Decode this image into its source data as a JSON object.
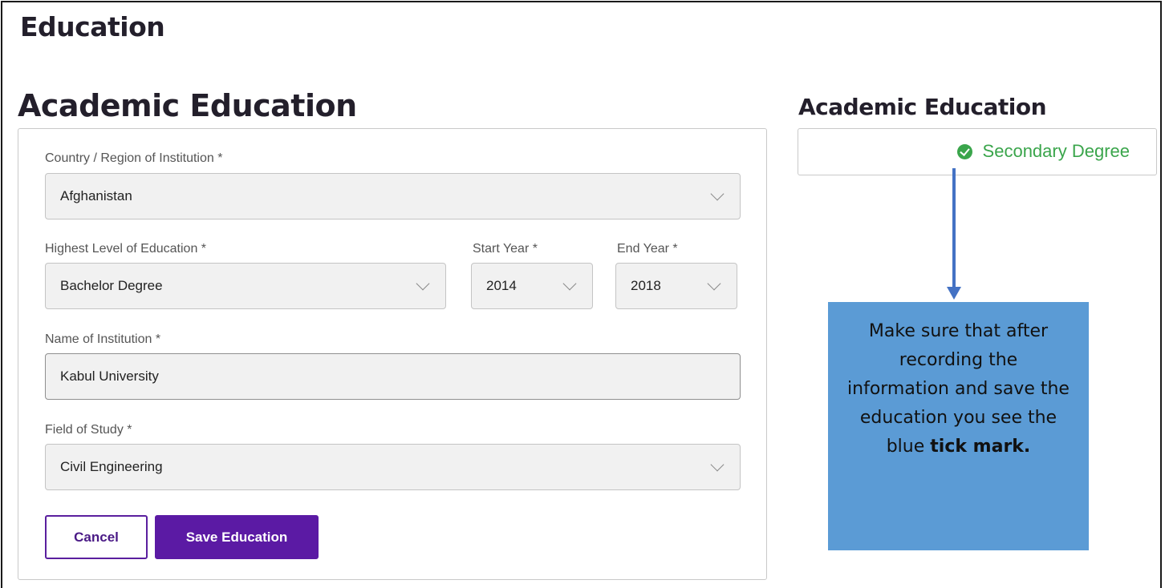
{
  "page": {
    "title": "Education",
    "section_title": "Academic Education"
  },
  "form": {
    "country": {
      "label": "Country / Region of Institution *",
      "value": "Afghanistan"
    },
    "level": {
      "label": "Highest Level of Education *",
      "value": "Bachelor Degree"
    },
    "start_year": {
      "label": "Start Year *",
      "value": "2014"
    },
    "end_year": {
      "label": "End Year *",
      "value": "2018"
    },
    "institution": {
      "label": "Name of Institution *",
      "value": "Kabul University"
    },
    "field_of_study": {
      "label": "Field of Study *",
      "value": "Civil Engineering"
    },
    "cancel_label": "Cancel",
    "save_label": "Save Education"
  },
  "summary": {
    "title": "Academic Education",
    "item_label": "Secondary Degree",
    "item_icon": "check-circle-icon",
    "item_color": "#3aa54b"
  },
  "callout": {
    "text_before": "Make sure that after recording the information and save the education you see the blue ",
    "text_bold": "tick mark.",
    "background": "#5b9bd5",
    "arrow_color": "#4472c4"
  },
  "colors": {
    "accent": "#5b1aa4"
  }
}
